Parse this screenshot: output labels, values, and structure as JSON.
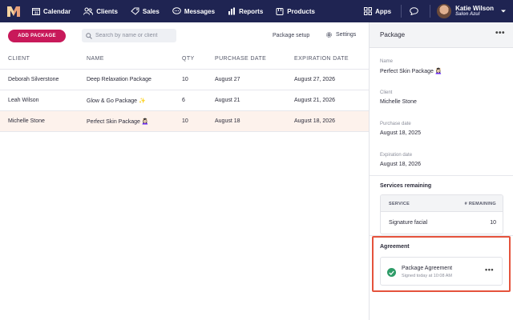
{
  "nav": {
    "items": [
      {
        "label": "Calendar",
        "icon": "calendar-icon"
      },
      {
        "label": "Clients",
        "icon": "users-icon"
      },
      {
        "label": "Sales",
        "icon": "tag-icon"
      },
      {
        "label": "Messages",
        "icon": "chat-icon"
      },
      {
        "label": "Reports",
        "icon": "bar-chart-icon"
      },
      {
        "label": "Products",
        "icon": "box-icon"
      }
    ],
    "apps_label": "Apps",
    "user_name": "Katie Wilson",
    "user_org": "Salon Azul",
    "brand_color": "#1f2452"
  },
  "toolbar": {
    "add_label": "ADD PACKAGE",
    "search_placeholder": "Search by name or client",
    "setup_label": "Package setup",
    "settings_label": "Settings",
    "accent_color": "#c8195a"
  },
  "table": {
    "headers": [
      "CLIENT",
      "NAME",
      "QTY",
      "PURCHASE DATE",
      "EXPIRATION DATE"
    ],
    "rows": [
      {
        "client": "Deborah Silverstone",
        "name": "Deep Relaxation Package",
        "qty": "10",
        "purchase": "August 27",
        "expiration": "August 27, 2026"
      },
      {
        "client": "Leah Wilson",
        "name": "Glow & Go Package ✨",
        "qty": "6",
        "purchase": "August 21",
        "expiration": "August 21, 2026"
      },
      {
        "client": "Michelle Stone",
        "name": "Perfect Skin Package 💆🏻‍♀️",
        "qty": "10",
        "purchase": "August 18",
        "expiration": "August 18, 2026",
        "selected": true
      }
    ]
  },
  "panel": {
    "title": "Package",
    "more": "•••",
    "fields": [
      {
        "label": "Name",
        "value": "Perfect Skin Package 💆🏻‍♀️"
      },
      {
        "label": "Client",
        "value": "Michelle Stone"
      },
      {
        "label": "Purchase date",
        "value": "August 18, 2025"
      },
      {
        "label": "Expiration date",
        "value": "August 18, 2026"
      }
    ],
    "services_title": "Services remaining",
    "services_headers": [
      "SERVICE",
      "# REMAINING"
    ],
    "services": [
      {
        "name": "Signature facial",
        "remaining": "10"
      }
    ],
    "agreement_title": "Agreement",
    "agreement": {
      "name": "Package Agreement",
      "status": "Signed today at 10:08 AM",
      "status_color": "#2e9c68"
    },
    "highlight_color": "#e5533c"
  }
}
